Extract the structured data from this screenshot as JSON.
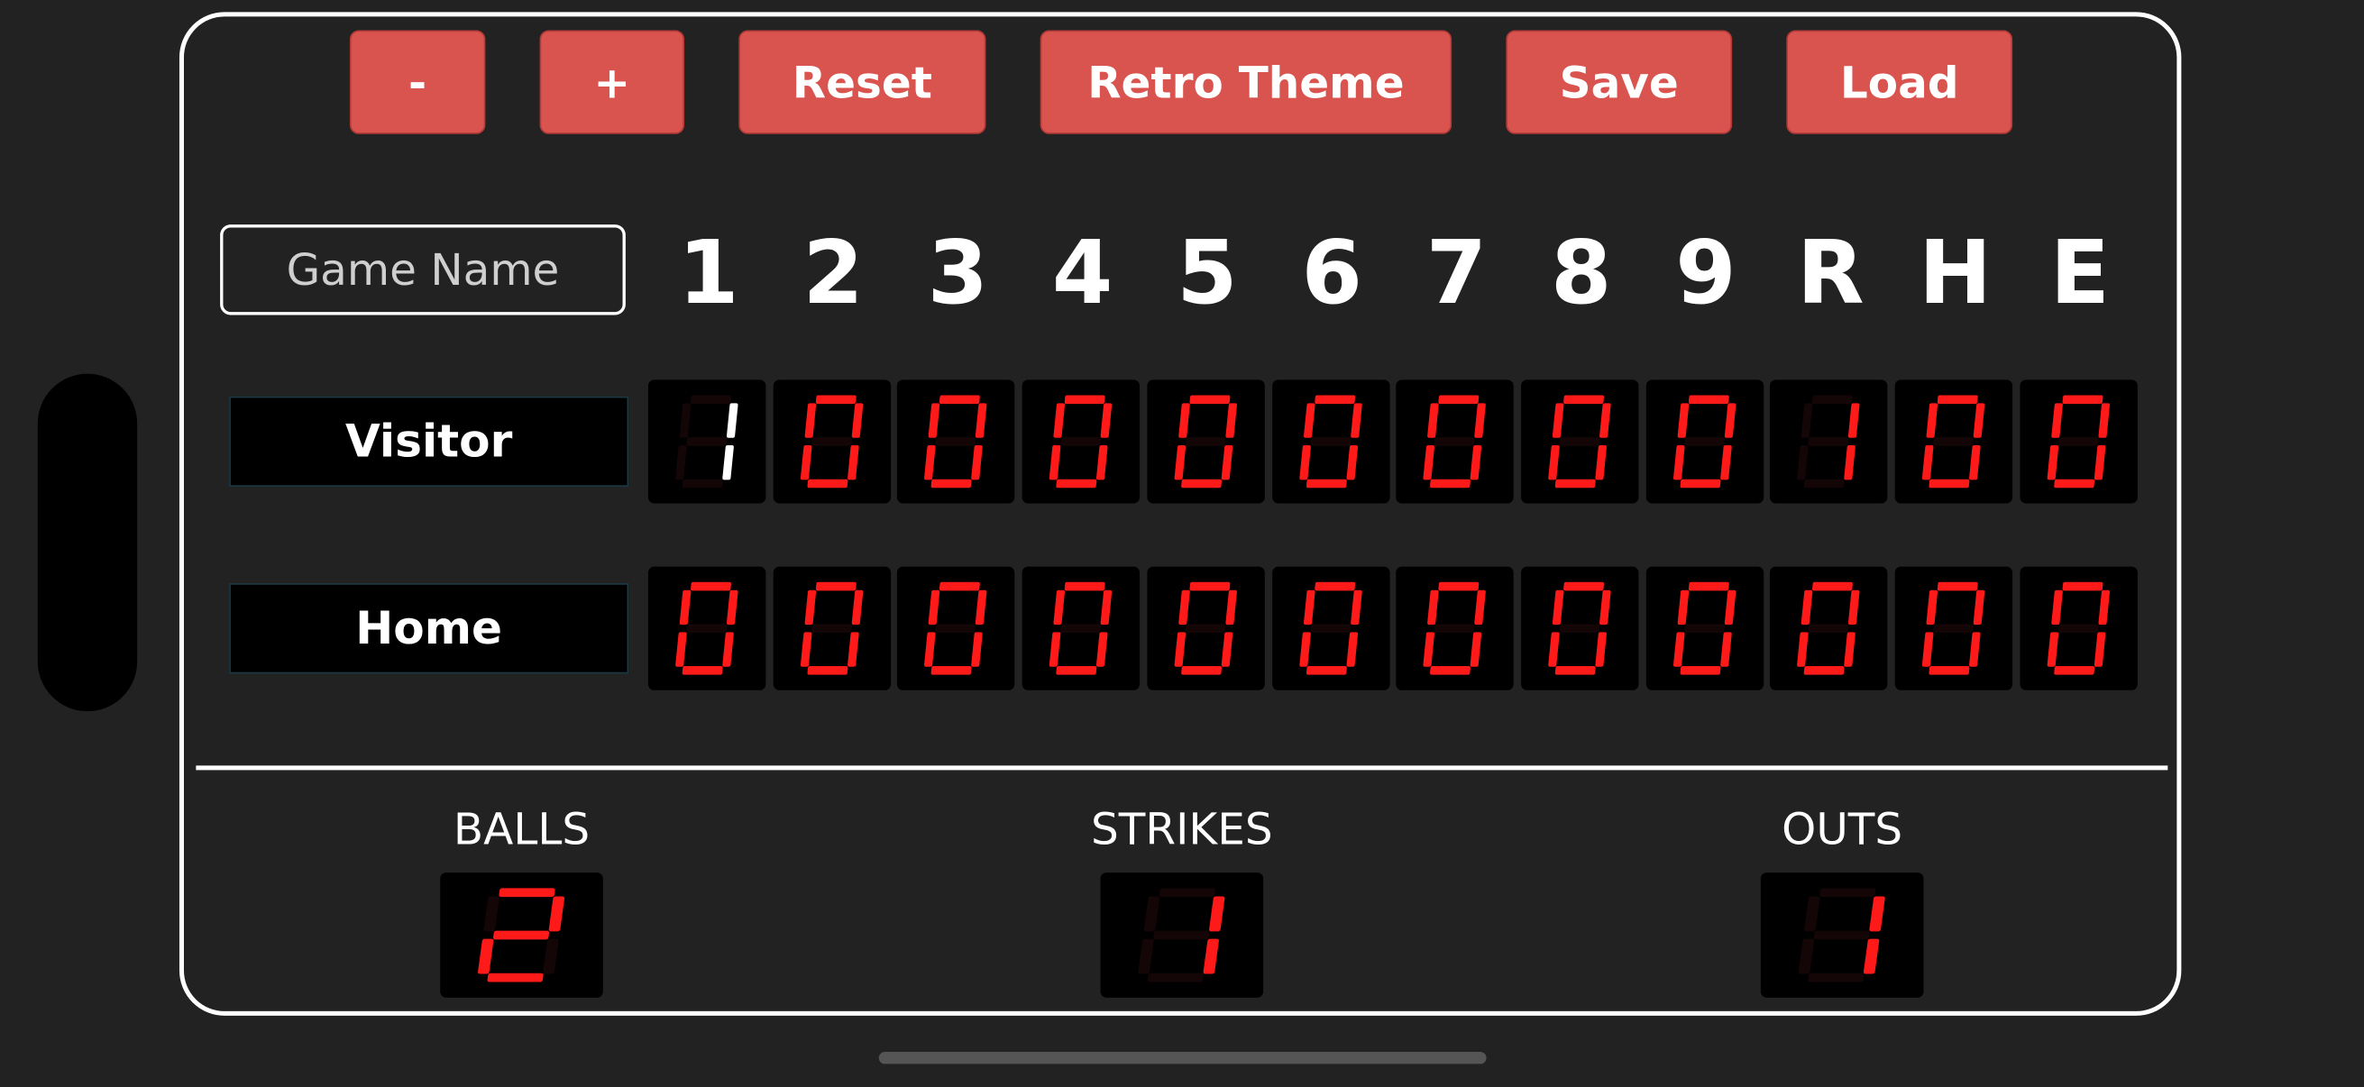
{
  "toolbar": {
    "minus_label": "-",
    "plus_label": "+",
    "reset_label": "Reset",
    "theme_label": "Retro Theme",
    "save_label": "Save",
    "load_label": "Load"
  },
  "game": {
    "name_value": "",
    "name_placeholder": "Game Name"
  },
  "columns": [
    "1",
    "2",
    "3",
    "4",
    "5",
    "6",
    "7",
    "8",
    "9",
    "R",
    "H",
    "E"
  ],
  "teams": [
    {
      "name": "Visitor",
      "scores": [
        "1",
        "0",
        "0",
        "0",
        "0",
        "0",
        "0",
        "0",
        "0",
        "1",
        "0",
        "0"
      ],
      "active_index": 0
    },
    {
      "name": "Home",
      "scores": [
        "0",
        "0",
        "0",
        "0",
        "0",
        "0",
        "0",
        "0",
        "0",
        "0",
        "0",
        "0"
      ],
      "active_index": -1
    }
  ],
  "counts": {
    "balls": {
      "label": "BALLS",
      "value": "2"
    },
    "strikes": {
      "label": "STRIKES",
      "value": "1"
    },
    "outs": {
      "label": "OUTS",
      "value": "1"
    }
  },
  "colors": {
    "background": "#222222",
    "button": "#d9534f",
    "digit_lit": "#ff1a1a",
    "digit_active": "#ffffff",
    "cell_bg": "#000000"
  }
}
